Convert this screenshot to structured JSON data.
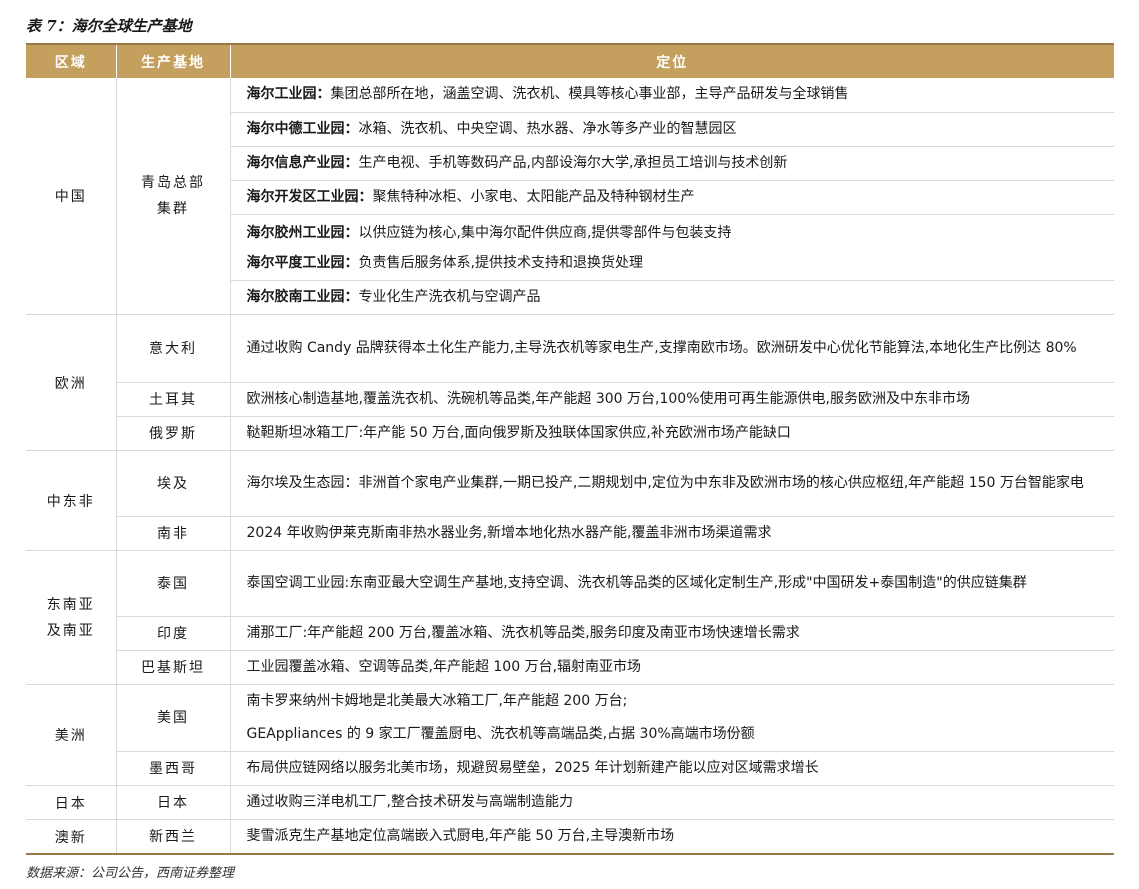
{
  "title": "表 7：海尔全球生产基地",
  "headers": {
    "region": "区域",
    "base": "生产基地",
    "position": "定位"
  },
  "rows": {
    "china": {
      "region": "中国",
      "base_line1": "青岛总部",
      "base_line2": "集群",
      "items": [
        {
          "label": "海尔工业园：",
          "text": "集团总部所在地，涵盖空调、洗衣机、模具等核心事业部，主导产品研发与全球销售"
        },
        {
          "label": "海尔中德工业园：",
          "text": "冰箱、洗衣机、中央空调、热水器、净水等多产业的智慧园区"
        },
        {
          "label": "海尔信息产业园：",
          "text": "生产电视、手机等数码产品,内部设海尔大学,承担员工培训与技术创新"
        },
        {
          "label": "海尔开发区工业园：",
          "text": "聚焦特种冰柜、小家电、太阳能产品及特种钢材生产"
        },
        {
          "label": "海尔胶州工业园：",
          "text": "以供应链为核心,集中海尔配件供应商,提供零部件与包装支持"
        },
        {
          "label": "海尔平度工业园：",
          "text": "负责售后服务体系,提供技术支持和退换货处理"
        },
        {
          "label": "海尔胶南工业园：",
          "text": "专业化生产洗衣机与空调产品"
        }
      ]
    },
    "europe": {
      "region": "欧洲",
      "italy": {
        "base": "意大利",
        "text": "通过收购 Candy 品牌获得本土化生产能力,主导洗衣机等家电生产,支撑南欧市场。欧洲研发中心优化节能算法,本地化生产比例达 80%"
      },
      "turkey": {
        "base": "土耳其",
        "text": "欧洲核心制造基地,覆盖洗衣机、洗碗机等品类,年产能超 300 万台,100%使用可再生能源供电,服务欧洲及中东非市场"
      },
      "russia": {
        "base": "俄罗斯",
        "text": "鞑靼斯坦冰箱工厂:年产能 50 万台,面向俄罗斯及独联体国家供应,补充欧洲市场产能缺口"
      }
    },
    "mea": {
      "region": "中东非",
      "egypt": {
        "base": "埃及",
        "text": "海尔埃及生态园：非洲首个家电产业集群,一期已投产,二期规划中,定位为中东非及欧洲市场的核心供应枢纽,年产能超 150 万台智能家电"
      },
      "south_africa": {
        "base": "南非",
        "text": "2024 年收购伊莱克斯南非热水器业务,新增本地化热水器产能,覆盖非洲市场渠道需求"
      }
    },
    "sea": {
      "region_line1": "东南亚",
      "region_line2": "及南亚",
      "thailand": {
        "base": "泰国",
        "text": "泰国空调工业园:东南亚最大空调生产基地,支持空调、洗衣机等品类的区域化定制生产,形成\"中国研发+泰国制造\"的供应链集群"
      },
      "india": {
        "base": "印度",
        "text": "浦那工厂:年产能超 200 万台,覆盖冰箱、洗衣机等品类,服务印度及南亚市场快速增长需求"
      },
      "pakistan": {
        "base": "巴基斯坦",
        "text": "工业园覆盖冰箱、空调等品类,年产能超 100 万台,辐射南亚市场"
      }
    },
    "americas": {
      "region": "美洲",
      "usa": {
        "base": "美国",
        "line1": "南卡罗来纳州卡姆地是北美最大冰箱工厂,年产能超 200 万台;",
        "line2": "GEAppliances 的 9 家工厂覆盖厨电、洗衣机等高端品类,占据 30%高端市场份额"
      },
      "mexico": {
        "base": "墨西哥",
        "text": "布局供应链网络以服务北美市场，规避贸易壁垒，2025 年计划新建产能以应对区域需求增长"
      }
    },
    "japan": {
      "region": "日本",
      "base": "日本",
      "text": "通过收购三洋电机工厂,整合技术研发与高端制造能力"
    },
    "oceania": {
      "region": "澳新",
      "base": "新西兰",
      "text": "斐雪派克生产基地定位高端嵌入式厨电,年产能 50 万台,主导澳新市场"
    }
  },
  "source": "数据来源：公司公告，西南证券整理"
}
